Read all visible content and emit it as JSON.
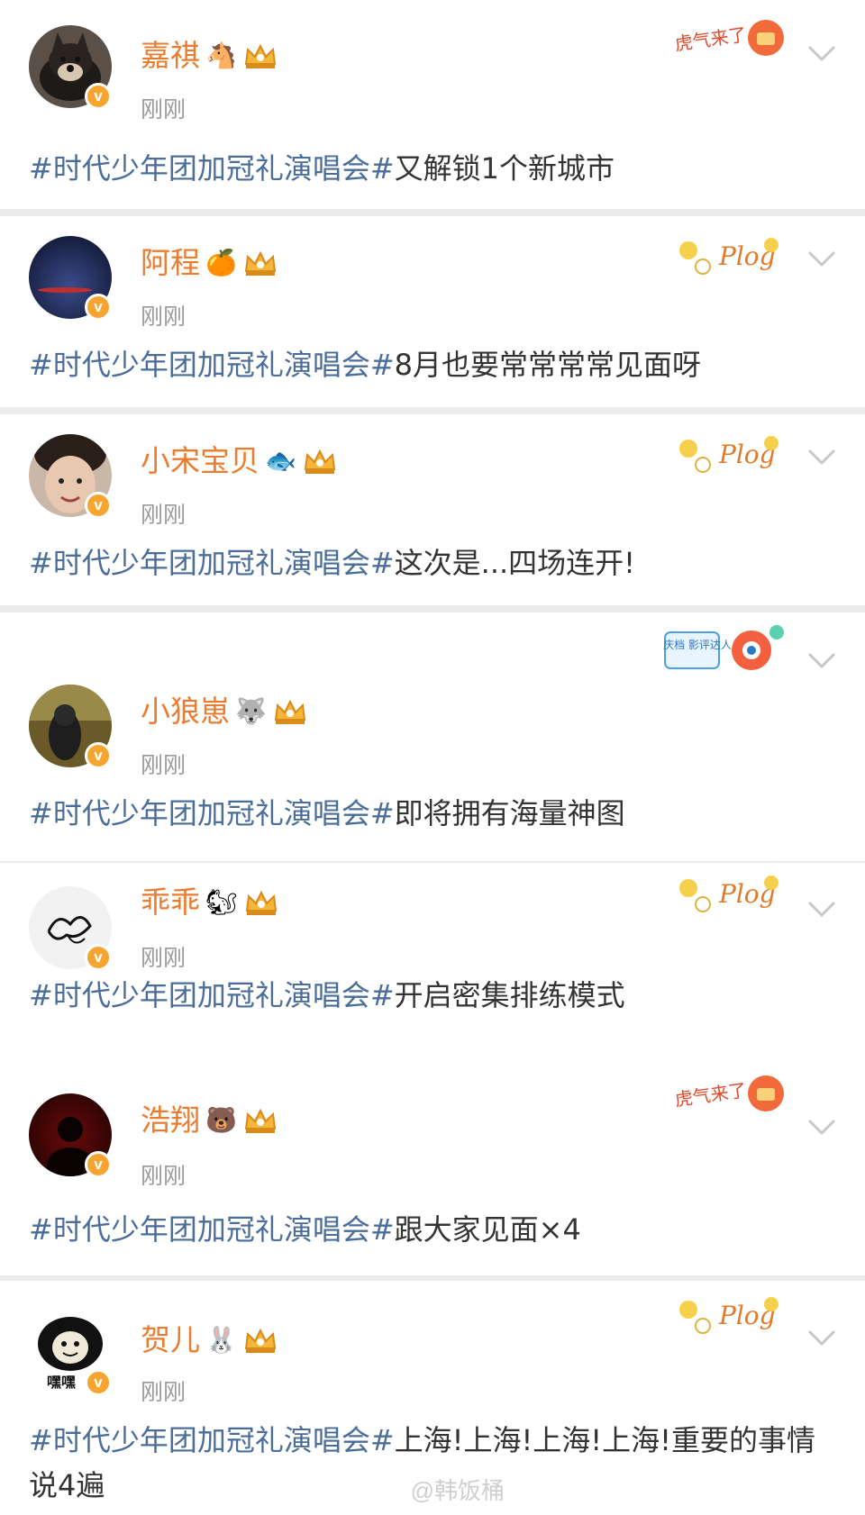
{
  "posts": [
    {
      "name": "嘉祺",
      "emoji": "🐴",
      "time": "刚刚",
      "topic": "#时代少年团加冠礼演唱会#",
      "content": "又解锁1个新城市",
      "sticker": "虎气来了"
    },
    {
      "name": "阿程",
      "emoji": "🍊",
      "time": "刚刚",
      "topic": "#时代少年团加冠礼演唱会#",
      "content": "8月也要常常常常见面呀",
      "sticker": "Plog"
    },
    {
      "name": "小宋宝贝",
      "emoji": "🐟",
      "time": "刚刚",
      "topic": "#时代少年团加冠礼演唱会#",
      "content": "这次是...四场连开!",
      "sticker": "Plog"
    },
    {
      "name": "小狼崽",
      "emoji": "🐺",
      "time": "刚刚",
      "topic": "#时代少年团加冠礼演唱会#",
      "content": "即将拥有海量神图",
      "sticker": "国庆档 影评达人"
    },
    {
      "name": "乖乖",
      "emoji": "🐿",
      "time": "刚刚",
      "topic": "#时代少年团加冠礼演唱会#",
      "content": "开启密集排练模式",
      "sticker": "Plog"
    },
    {
      "name": "浩翔",
      "emoji": "🐻",
      "time": "刚刚",
      "topic": "#时代少年团加冠礼演唱会#",
      "content": "跟大家见面×4",
      "sticker": "虎气来了"
    },
    {
      "name": "贺儿",
      "emoji": "🐰",
      "time": "刚刚",
      "topic": "#时代少年团加冠礼演唱会#",
      "content": "上海!上海!上海!上海!重要的事情说4遍",
      "sticker": "Plog"
    }
  ],
  "avatars": [
    "黑白柴犬",
    "夜色",
    "自拍",
    "冷色调",
    "签名",
    "剪影",
    "嘿嘿"
  ],
  "watermark": "@韩饭桶",
  "colors": {
    "name": "#eb7b2e",
    "topic": "#4a6d9a",
    "badge": "#f7a530",
    "time": "#9a9a9a"
  }
}
